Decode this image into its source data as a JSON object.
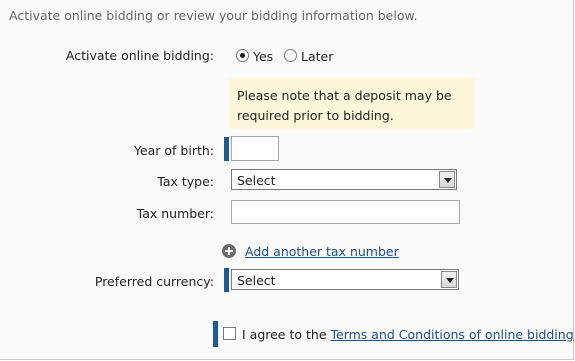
{
  "intro": "Activate online bidding or review your bidding information below.",
  "activate": {
    "label": "Activate online bidding:",
    "option_yes": "Yes",
    "option_later": "Later",
    "selected": "Yes"
  },
  "note": "Please note that a deposit may be required prior to bidding.",
  "year_of_birth": {
    "label": "Year of birth:",
    "value": ""
  },
  "tax_type": {
    "label": "Tax type:",
    "value": "Select"
  },
  "tax_number": {
    "label": "Tax number:",
    "value": ""
  },
  "add_tax_link": "Add another tax number",
  "currency": {
    "label": "Preferred currency:",
    "value": "Select"
  },
  "agree": {
    "prefix": "I agree to the",
    "link": "Terms and Conditions of online bidding",
    "checked": false
  },
  "colors": {
    "required_bar": "#1a5c9a",
    "link": "#1a4f9a",
    "note_bg": "#fdf7d9"
  }
}
